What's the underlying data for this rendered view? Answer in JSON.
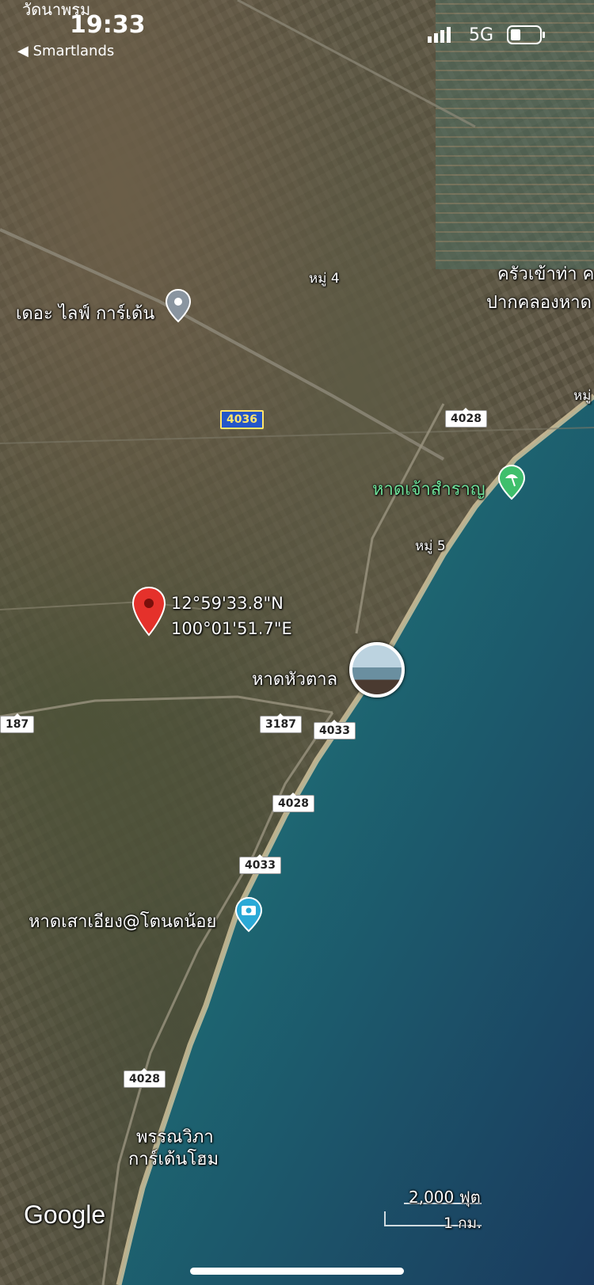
{
  "status_bar": {
    "time": "19:33",
    "back_app": "Smartlands",
    "network": "5G",
    "top_partial_label": "วัดนาพรม"
  },
  "map": {
    "dropped_pin": {
      "lat": "12°59'33.8\"N",
      "lon": "100°01'51.7\"E"
    },
    "places": {
      "the_life_garden": "เดอะ ไลฟ์ การ์เด้น",
      "moo4": "หมู่ 4",
      "krua_khao_tha_1": "ครัวเข้าท่า ค",
      "krua_khao_tha_2": "ปากคลองหาด",
      "moo_right": "หมู่",
      "hat_chao_samran": "หาดเจ้าสำราญ",
      "moo5": "หมู่ 5",
      "hat_hua_tan": "หาดหัวตาล",
      "hat_sao_eiang": "หาดเสาเอียง@โตนดน้อย",
      "pornwipa_1": "พรรณวิภา",
      "pornwipa_2": "การ์เด้นโฮม"
    },
    "roads": {
      "r4036": "4036",
      "r4028_top": "4028",
      "r3187": "3187",
      "r3187_left": "187",
      "r4033_a": "4033",
      "r4028_mid": "4028",
      "r4033_b": "4033",
      "r4028_bottom": "4028"
    },
    "scale": {
      "feet": "2,000 ฟุต",
      "km": "1 กม."
    },
    "brand": "Google"
  },
  "colors": {
    "pin_red": "#e5312b",
    "sea_teal": "#1f6d77",
    "sea_deep": "#1c3f63",
    "poi_green": "#3fbf6c",
    "poi_blue": "#2aa9d6"
  }
}
